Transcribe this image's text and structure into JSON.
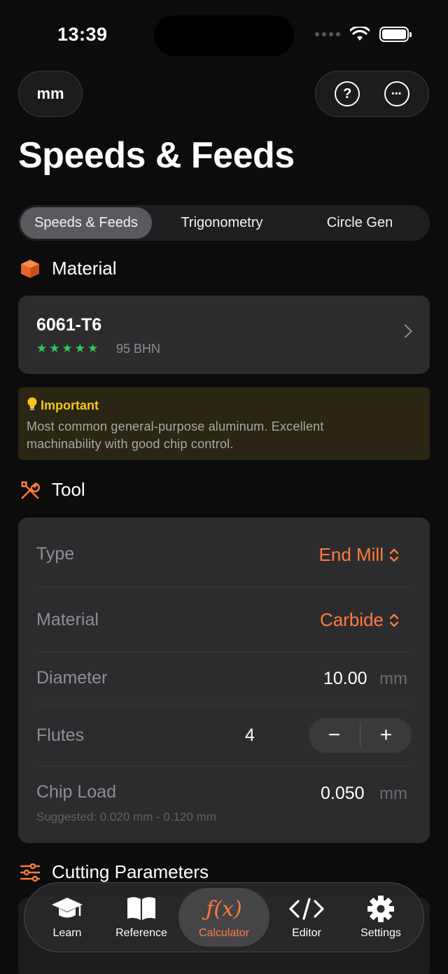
{
  "status": {
    "time": "13:39"
  },
  "header": {
    "unit_button": "mm",
    "help_icon": "?",
    "more_icon": "•••",
    "title": "Speeds & Feeds"
  },
  "segmented": {
    "tabs": [
      "Speeds & Feeds",
      "Trigonometry",
      "Circle Gen"
    ],
    "active": "Speeds & Feeds"
  },
  "material_section": {
    "heading": "Material",
    "icon": "cube-icon",
    "card": {
      "name": "6061-T6",
      "rating": 5,
      "stars": "★★★★★",
      "hardness": "95 BHN"
    },
    "note": {
      "title": "Important",
      "text_line1": "Most common general-purpose aluminum. Excellent",
      "text_line2": "machinability with good chip control."
    }
  },
  "tool_section": {
    "heading": "Tool",
    "icon": "tools-icon",
    "type": {
      "label": "Type",
      "value": "End Mill"
    },
    "material": {
      "label": "Material",
      "value": "Carbide"
    },
    "diameter": {
      "label": "Diameter",
      "value": "10.00",
      "unit": "mm"
    },
    "flutes": {
      "label": "Flutes",
      "value": "4",
      "minus": "−",
      "plus": "+"
    },
    "chip_load": {
      "label": "Chip Load",
      "value": "0.050",
      "unit": "mm",
      "suggested": "Suggested: 0.020 mm - 0.120 mm"
    }
  },
  "cutting_section": {
    "heading": "Cutting Parameters",
    "icon": "sliders-icon"
  },
  "tabbar": {
    "tabs": [
      {
        "label": "Learn",
        "icon": "graduation-cap-icon"
      },
      {
        "label": "Reference",
        "icon": "book-icon"
      },
      {
        "label": "Calculator",
        "icon": "function-icon",
        "glyph": "ƒ(x)"
      },
      {
        "label": "Editor",
        "icon": "code-icon",
        "glyph": "</>"
      },
      {
        "label": "Settings",
        "icon": "gear-icon"
      }
    ],
    "active": "Calculator"
  },
  "colors": {
    "accent": "#ff7a3d",
    "stars": "#34c759",
    "note_title": "#f5c518",
    "card_bg": "#2c2c2e"
  }
}
